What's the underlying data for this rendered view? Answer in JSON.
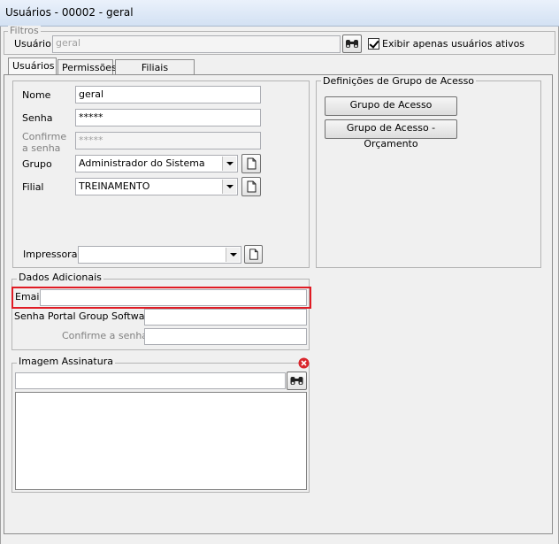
{
  "window": {
    "title": "Usuários - 00002 - geral"
  },
  "filters": {
    "legend": "Filtros",
    "user_label": "Usuário",
    "user_value": "geral",
    "only_active_label": "Exibir apenas usuários ativos",
    "only_active_checked": true
  },
  "tabs": [
    {
      "label": "Usuários",
      "active": true
    },
    {
      "label": "Permissões",
      "active": false
    },
    {
      "label": "Filiais Permitidas",
      "active": false
    }
  ],
  "user_form": {
    "name_label": "Nome",
    "name_value": "geral",
    "password_label": "Senha",
    "password_value": "*****",
    "confirm_label_1": "Confirme",
    "confirm_label_2": "a senha",
    "confirm_value": "*****",
    "group_label": "Grupo",
    "group_value": "Administrador do Sistema",
    "branch_label": "Filial",
    "branch_value": "TREINAMENTO",
    "printer_label": "Impressora",
    "printer_value": ""
  },
  "access_group": {
    "legend": "Definições de Grupo de Acesso",
    "btn_group": "Grupo de Acesso",
    "btn_budget": "Grupo de Acesso - Orçamento"
  },
  "additional": {
    "legend": "Dados Adicionais",
    "email_label": "Email",
    "email_value": "",
    "portal_password_label": "Senha Portal Group Software",
    "portal_password_value": "",
    "portal_confirm_label": "Confirme a senha",
    "portal_confirm_value": ""
  },
  "signature": {
    "legend": "Imagem Assinatura",
    "path_value": ""
  },
  "colors": {
    "highlight": "#e01b24",
    "clear_icon": "#d9262c"
  }
}
